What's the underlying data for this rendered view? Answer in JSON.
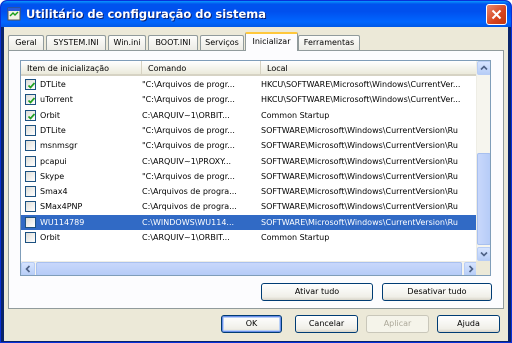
{
  "window": {
    "title": "Utilitário de configuração do sistema",
    "icon": "msconfig-app-icon",
    "close_icon": "close-icon"
  },
  "tabs": [
    {
      "label": "Geral",
      "active": false
    },
    {
      "label": "SYSTEM.INI",
      "active": false
    },
    {
      "label": "Win.ini",
      "active": false
    },
    {
      "label": "BOOT.INI",
      "active": false
    },
    {
      "label": "Serviços",
      "active": false
    },
    {
      "label": "Inicializar",
      "active": true
    },
    {
      "label": "Ferramentas",
      "active": false
    }
  ],
  "list": {
    "columns": [
      "Item de inicialização",
      "Comando",
      "Local"
    ],
    "rows": [
      {
        "checked": true,
        "name": "DTLite",
        "command": "\"C:\\Arquivos de progr...",
        "location": "HKCU\\SOFTWARE\\Microsoft\\Windows\\CurrentVer...",
        "selected": false
      },
      {
        "checked": true,
        "name": "uTorrent",
        "command": "\"C:\\Arquivos de progr...",
        "location": "HKCU\\SOFTWARE\\Microsoft\\Windows\\CurrentVer...",
        "selected": false
      },
      {
        "checked": true,
        "name": "Orbit",
        "command": "C:\\ARQUIV~1\\ORBIT...",
        "location": "Common Startup",
        "selected": false
      },
      {
        "checked": false,
        "name": "DTLite",
        "command": "\"C:\\Arquivos de progr...",
        "location": "SOFTWARE\\Microsoft\\Windows\\CurrentVersion\\Ru",
        "selected": false
      },
      {
        "checked": false,
        "name": "msnmsgr",
        "command": "\"C:\\Arquivos de progr...",
        "location": "SOFTWARE\\Microsoft\\Windows\\CurrentVersion\\Ru",
        "selected": false
      },
      {
        "checked": false,
        "name": "pcapui",
        "command": "C:\\ARQUIV~1\\PROXY...",
        "location": "SOFTWARE\\Microsoft\\Windows\\CurrentVersion\\Ru",
        "selected": false
      },
      {
        "checked": false,
        "name": "Skype",
        "command": "\"C:\\Arquivos de progr...",
        "location": "SOFTWARE\\Microsoft\\Windows\\CurrentVersion\\Ru",
        "selected": false
      },
      {
        "checked": false,
        "name": "Smax4",
        "command": "C:\\Arquivos de progra...",
        "location": "SOFTWARE\\Microsoft\\Windows\\CurrentVersion\\Ru",
        "selected": false
      },
      {
        "checked": false,
        "name": "SMax4PNP",
        "command": "C:\\Arquivos de progra...",
        "location": "SOFTWARE\\Microsoft\\Windows\\CurrentVersion\\Ru",
        "selected": false
      },
      {
        "checked": false,
        "name": "WU114789",
        "command": "C:\\WINDOWS\\WU114...",
        "location": "SOFTWARE\\Microsoft\\Windows\\CurrentVersion\\Ru",
        "selected": true
      },
      {
        "checked": false,
        "name": "Orbit",
        "command": "C:\\ARQUIV~1\\ORBIT...",
        "location": "Common Startup",
        "selected": false
      }
    ]
  },
  "panel_buttons": {
    "enable_all": "Ativar tudo",
    "disable_all": "Desativar tudo"
  },
  "dialog_buttons": {
    "ok": "OK",
    "cancel": "Cancelar",
    "apply": "Aplicar",
    "help": "Ajuda"
  },
  "colors": {
    "title_bar": "#0053ee",
    "selection": "#316ac5",
    "active_tab_accent": "#ffc83c",
    "checkmark": "#21a121"
  }
}
